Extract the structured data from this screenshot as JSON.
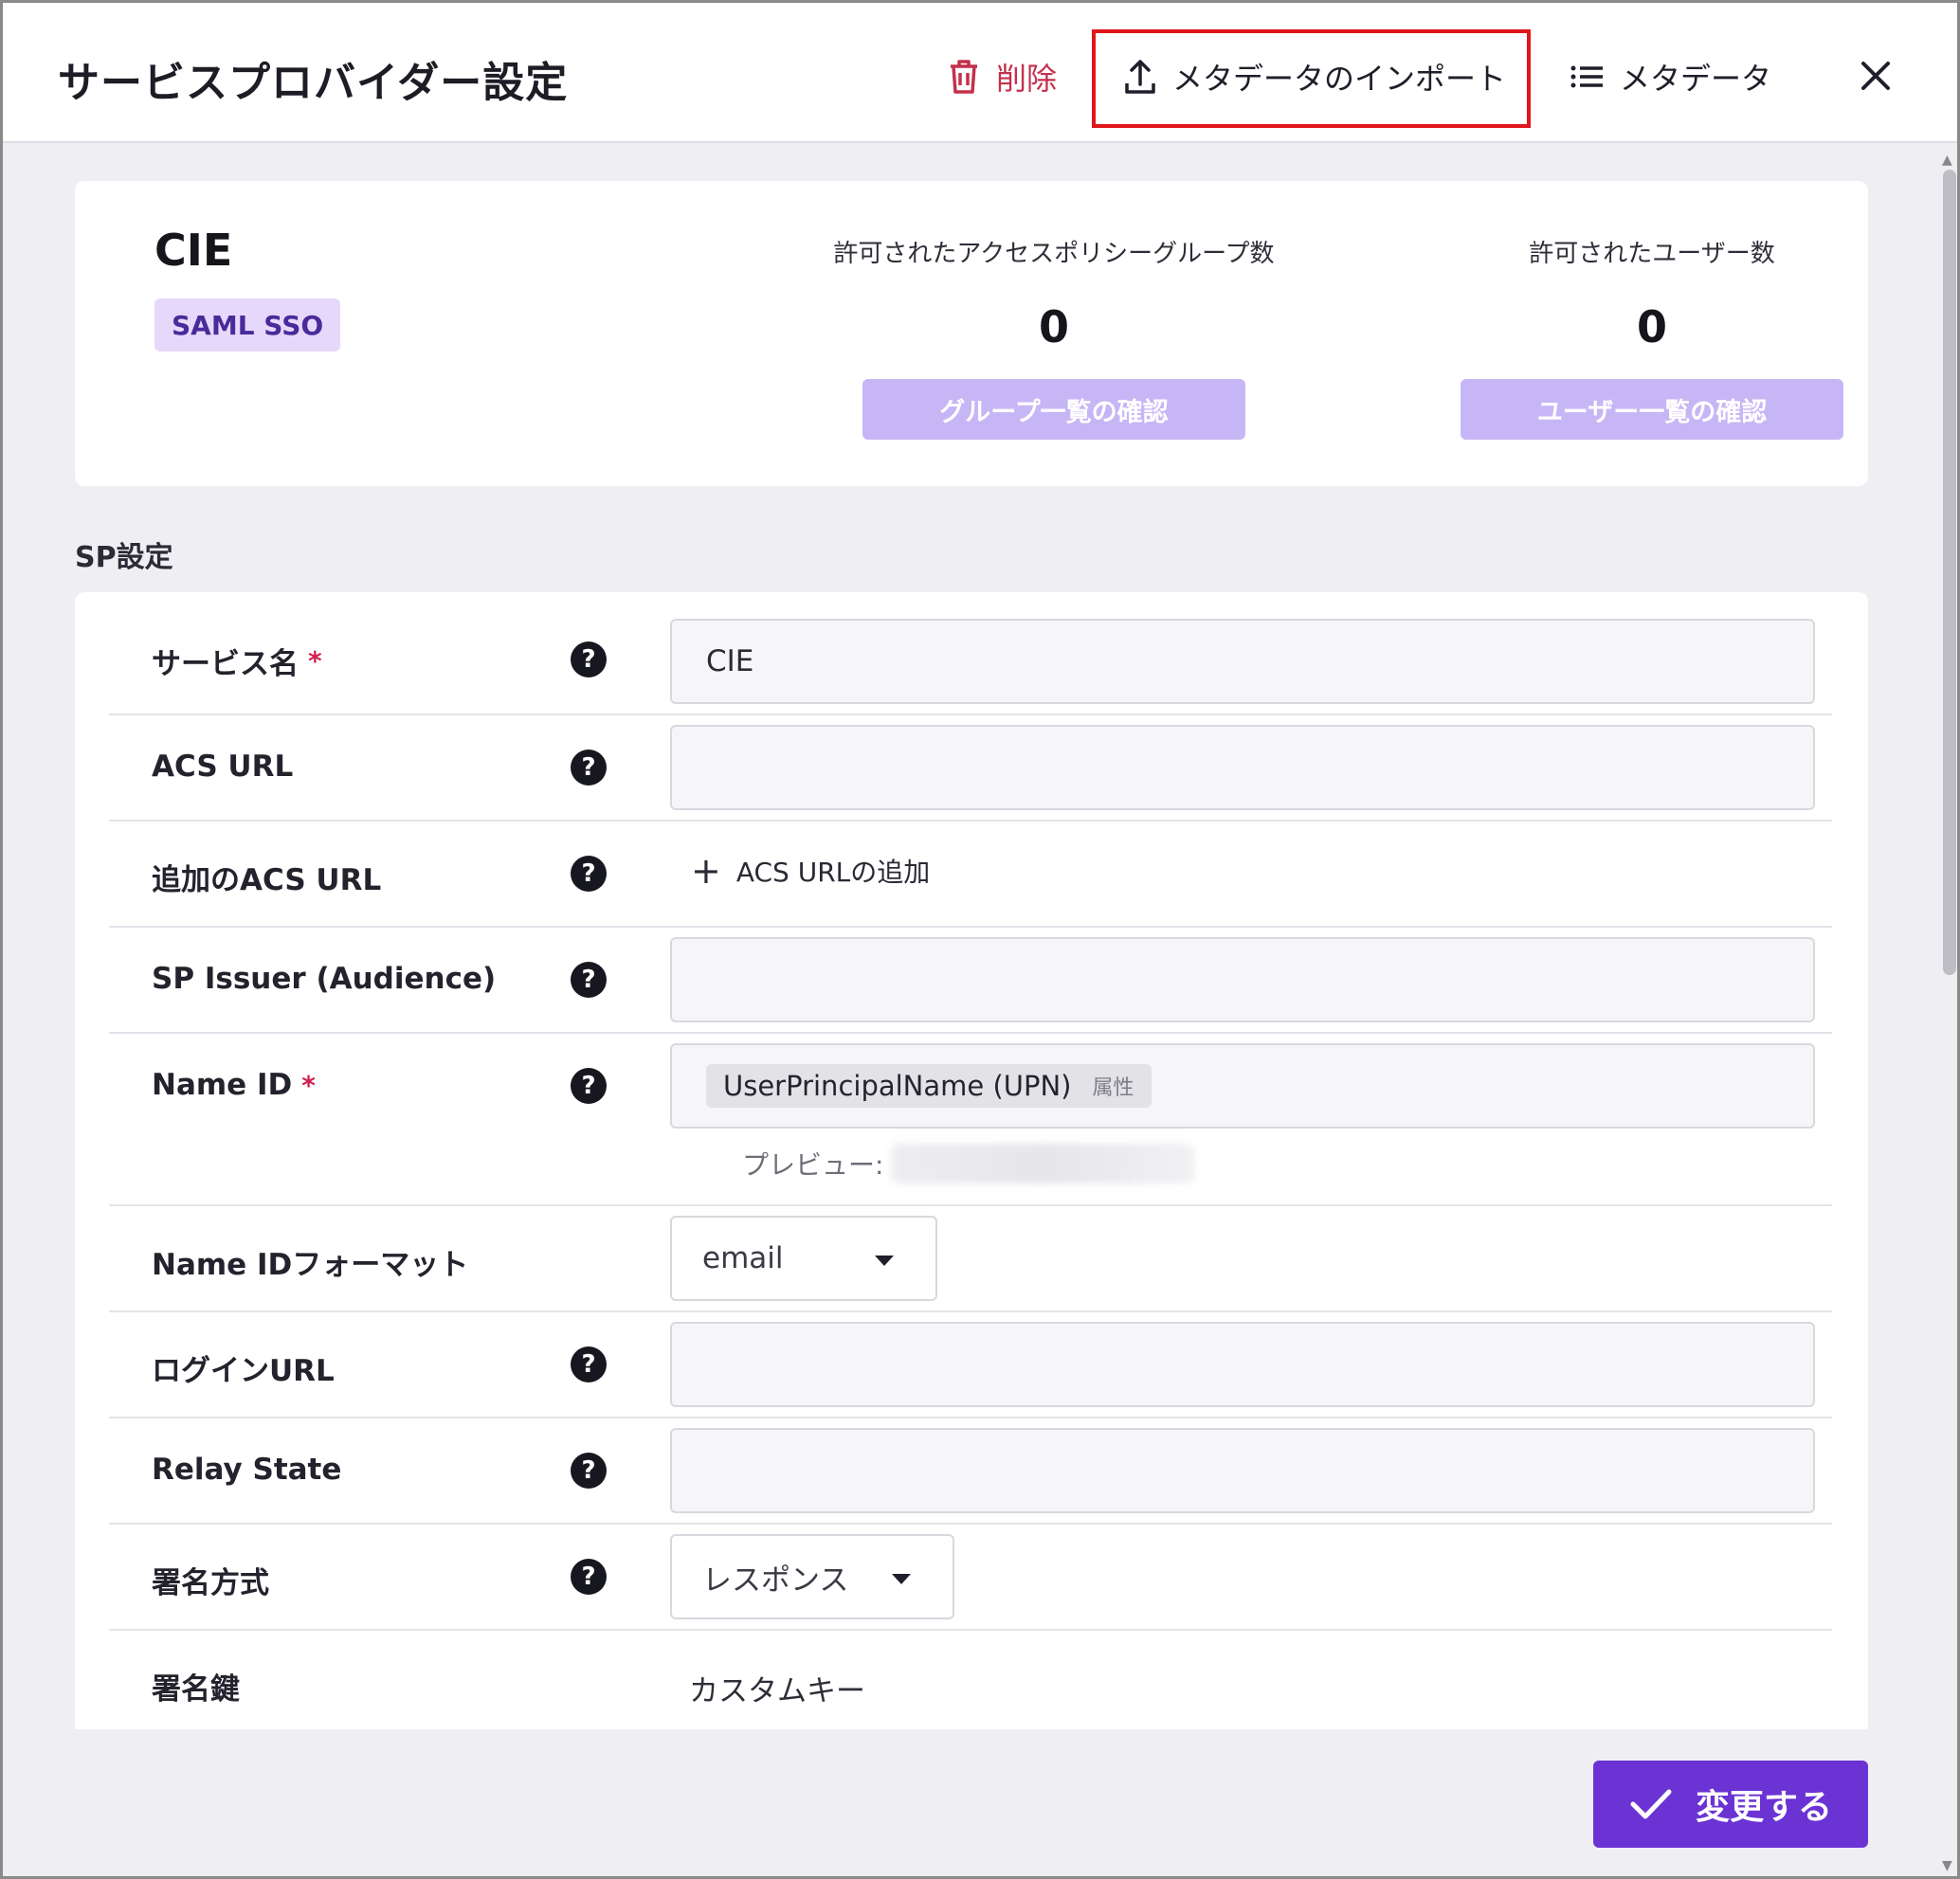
{
  "header": {
    "title": "サービスプロバイダー設定",
    "delete_label": "削除",
    "import_label": "メタデータのインポート",
    "metadata_label": "メタデータ"
  },
  "summary": {
    "app_name": "CIE",
    "badge": "SAML SSO",
    "groups": {
      "label": "許可されたアクセスポリシーグループ数",
      "value": "0",
      "button": "グループ一覧の確認"
    },
    "users": {
      "label": "許可されたユーザー数",
      "value": "0",
      "button": "ユーザー一覧の確認"
    }
  },
  "section_title": "SP設定",
  "form": {
    "service_name": {
      "label": "サービス名",
      "required": "*",
      "value": "CIE"
    },
    "acs_url": {
      "label": "ACS URL",
      "value": ""
    },
    "additional_acs": {
      "label": "追加のACS URL",
      "add_label": "ACS URLの追加"
    },
    "sp_issuer": {
      "label": "SP Issuer (Audience)",
      "value": ""
    },
    "name_id": {
      "label": "Name ID",
      "required": "*",
      "chip": "UserPrincipalName (UPN)",
      "chip_tag": "属性",
      "preview_label": "プレビュー:"
    },
    "name_id_format": {
      "label": "Name IDフォーマット",
      "selected": "email"
    },
    "login_url": {
      "label": "ログインURL",
      "value": ""
    },
    "relay_state": {
      "label": "Relay State",
      "value": ""
    },
    "signature_method": {
      "label": "署名方式",
      "selected": "レスポンス"
    },
    "signature_key": {
      "label": "署名鍵",
      "value": "カスタムキー"
    }
  },
  "footer": {
    "submit_label": "変更する"
  },
  "colors": {
    "accent": "#6b33d4",
    "danger": "#c4304c",
    "highlight": "#e0161b",
    "badge_bg": "#e6d8fb"
  },
  "icons": {
    "delete": "trash-icon",
    "import": "upload-icon",
    "metadata": "list-icon",
    "close": "close-icon",
    "help": "help-icon",
    "submit": "check-icon"
  }
}
